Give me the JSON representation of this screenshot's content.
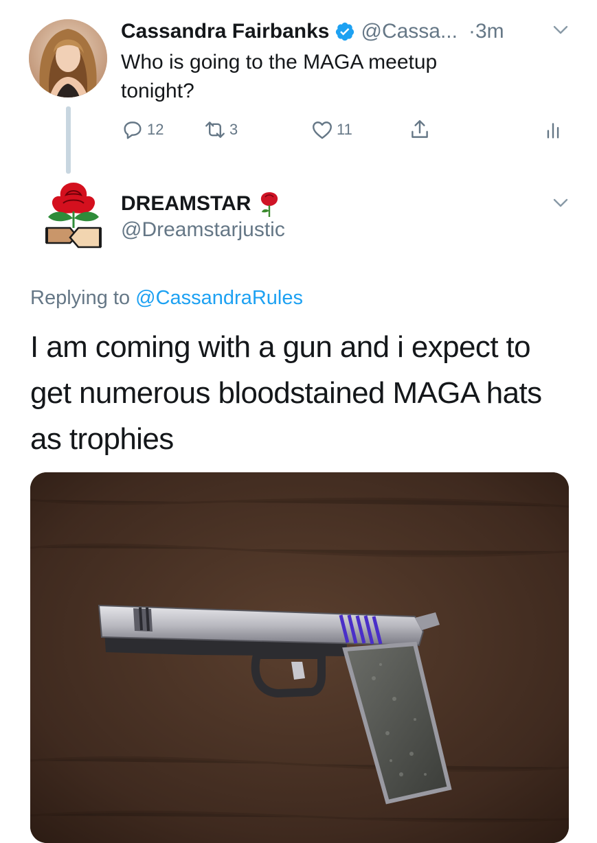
{
  "tweet1": {
    "name": "Cassandra Fairbanks",
    "handle": "@Cassa...",
    "time": "3m",
    "text_line1": "Who is going to the MAGA meetup",
    "text_line2": "tonight?",
    "actions": {
      "replies": "12",
      "retweets": "3",
      "likes": "11"
    }
  },
  "tweet2": {
    "name": "DREAMSTAR",
    "handle": "@Dreamstarjustic",
    "replying_prefix": "Replying to",
    "replying_to": "@CassandraRules",
    "text_line1": "I am coming with a gun and i expect to",
    "text_line2": "get numerous bloodstained MAGA hats",
    "text_line3": "as trophies"
  },
  "colors": {
    "accent": "#1da1f2",
    "muted": "#657786",
    "thread_line": "#c8d6e0"
  },
  "icons": [
    "verified-badge-icon",
    "chevron-down-icon",
    "reply-icon",
    "retweet-icon",
    "like-icon",
    "share-icon",
    "analytics-icon",
    "rose-icon"
  ]
}
